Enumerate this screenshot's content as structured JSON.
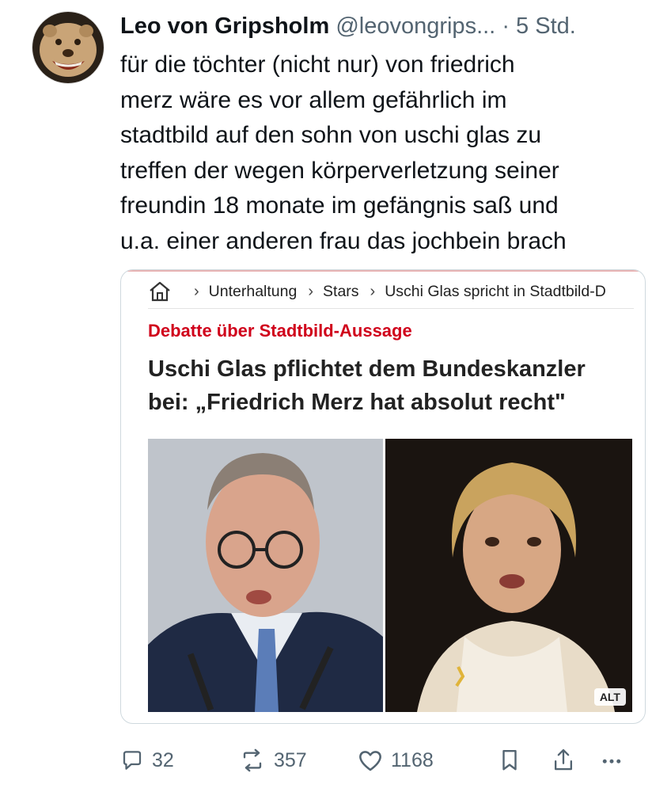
{
  "tweet": {
    "author_name": "Leo von Gripsholm",
    "handle": "@leovongrips...",
    "separator": "·",
    "time": "5 Std.",
    "text_lines": [
      "für die töchter (nicht nur) von friedrich",
      "merz wäre es vor allem gefährlich im",
      "stadtbild auf den sohn von uschi glas zu",
      "treffen der wegen körperverletzung seiner",
      "freundin 18 monate im gefängnis saß und",
      "u.a. einer anderen frau das jochbein brach"
    ]
  },
  "card": {
    "breadcrumb": [
      "Unterhaltung",
      "Stars",
      "Uschi Glas spricht in Stadtbild-D"
    ],
    "kicker": "Debatte über Stadtbild-Aussage",
    "headline_lines": [
      "Uschi Glas pflichtet dem Bundeskanzler",
      "bei: „Friedrich Merz hat absolut recht\""
    ],
    "alt_badge": "ALT"
  },
  "actions": {
    "replies": "32",
    "reposts": "357",
    "likes": "1168"
  },
  "colors": {
    "text": "#0f1419",
    "secondary": "#536471",
    "kicker_red": "#d0021b",
    "border": "#cfd9de"
  },
  "icons": [
    "reply-icon",
    "repost-icon",
    "like-icon",
    "bookmark-icon",
    "share-icon",
    "more-icon",
    "home-icon"
  ]
}
